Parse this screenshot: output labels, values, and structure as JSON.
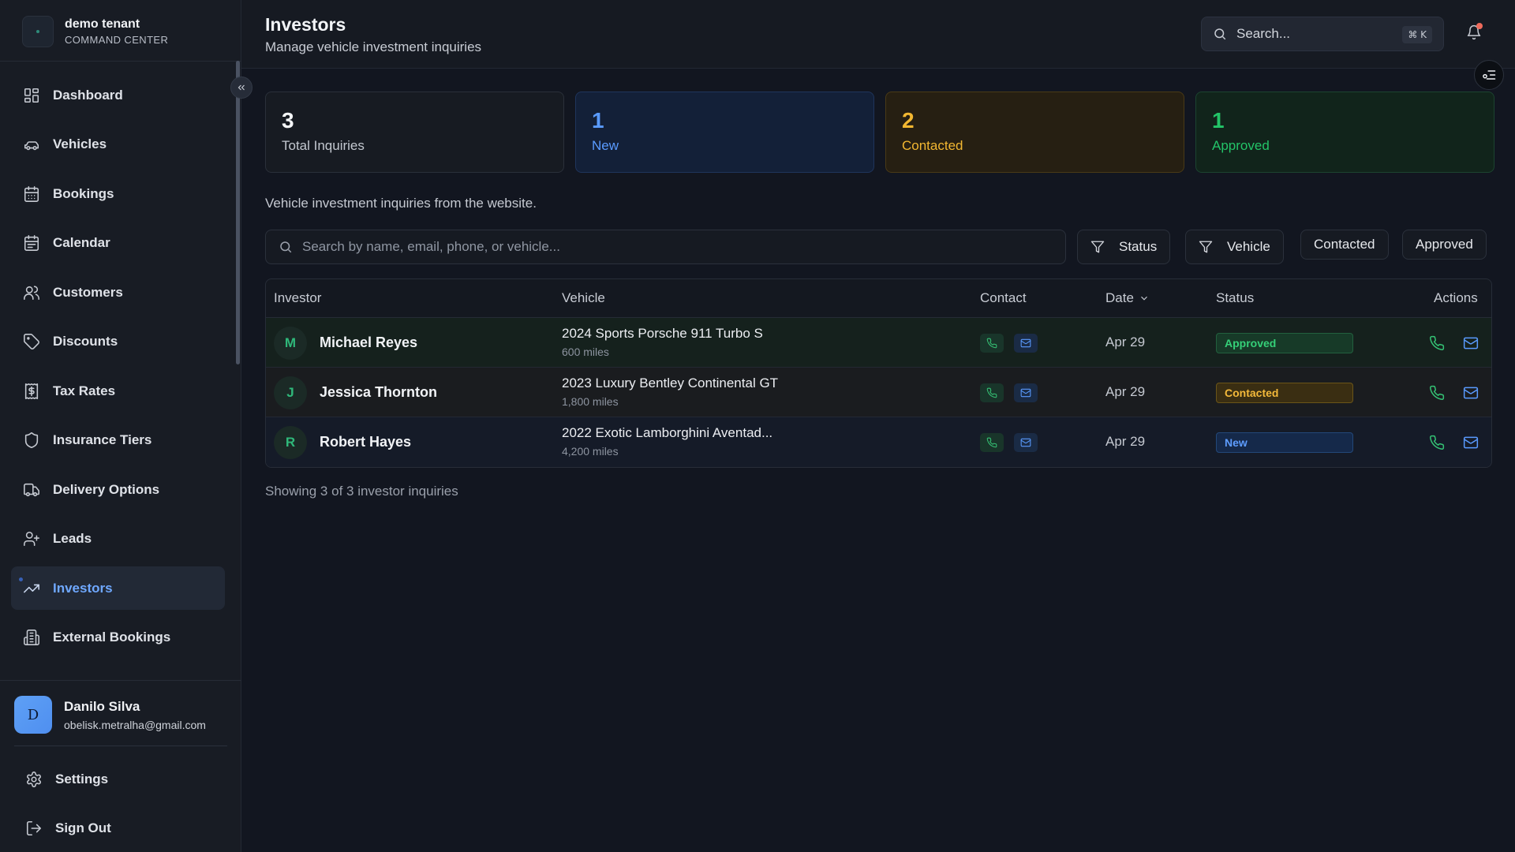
{
  "brand": {
    "title": "demo tenant",
    "subtitle": "COMMAND CENTER"
  },
  "sidebar": {
    "items": [
      {
        "label": "Dashboard",
        "icon": "dashboard-icon"
      },
      {
        "label": "Vehicles",
        "icon": "car-icon"
      },
      {
        "label": "Bookings",
        "icon": "calendar-grid-icon"
      },
      {
        "label": "Calendar",
        "icon": "calendar-icon"
      },
      {
        "label": "Customers",
        "icon": "users-icon"
      },
      {
        "label": "Discounts",
        "icon": "tag-icon"
      },
      {
        "label": "Tax Rates",
        "icon": "receipt-dollar-icon"
      },
      {
        "label": "Insurance Tiers",
        "icon": "shield-icon"
      },
      {
        "label": "Delivery Options",
        "icon": "truck-icon"
      },
      {
        "label": "Leads",
        "icon": "user-plus-icon"
      },
      {
        "label": "Investors",
        "icon": "trending-up-icon",
        "active": true
      },
      {
        "label": "External Bookings",
        "icon": "building-icon"
      }
    ],
    "active": "Investors"
  },
  "user": {
    "initial": "D",
    "name": "Danilo Silva",
    "email": "obelisk.metralha@gmail.com"
  },
  "bottom": {
    "settings": "Settings",
    "sign_out": "Sign Out"
  },
  "header": {
    "title": "Investors",
    "subtitle": "Manage vehicle investment inquiries",
    "search_placeholder": "Search...",
    "shortcut": "⌘ K"
  },
  "stats": {
    "total": {
      "value": "3",
      "label": "Total Inquiries"
    },
    "new": {
      "value": "1",
      "label": "New"
    },
    "contacted": {
      "value": "2",
      "label": "Contacted"
    },
    "approved": {
      "value": "1",
      "label": "Approved"
    }
  },
  "description": "Vehicle investment inquiries from the website.",
  "filters": {
    "search_placeholder": "Search by name, email, phone, or vehicle...",
    "status": "Status",
    "vehicle": "Vehicle",
    "contacted": "Contacted",
    "approved": "Approved"
  },
  "table": {
    "columns": {
      "investor": "Investor",
      "vehicle": "Vehicle",
      "contact": "Contact",
      "date": "Date",
      "status": "Status",
      "actions": "Actions"
    },
    "rows": [
      {
        "initial": "M",
        "name": "Michael Reyes",
        "vehicle": "2024 Sports Porsche 911 Turbo S",
        "miles": "600 miles",
        "date": "Apr 29",
        "status": "Approved"
      },
      {
        "initial": "J",
        "name": "Jessica Thornton",
        "vehicle": "2023 Luxury Bentley Continental GT",
        "miles": "1,800 miles",
        "date": "Apr 29",
        "status": "Contacted"
      },
      {
        "initial": "R",
        "name": "Robert Hayes",
        "vehicle": "2022 Exotic Lamborghini Aventad...",
        "miles": "4,200 miles",
        "date": "Apr 29",
        "status": "New"
      }
    ]
  },
  "footer": "Showing 3 of 3 investor inquiries",
  "colors": {
    "accent": "#5a9bff",
    "new": "#5a9bff",
    "contacted": "#f2b731",
    "approved": "#23c468",
    "background": "#121620"
  }
}
